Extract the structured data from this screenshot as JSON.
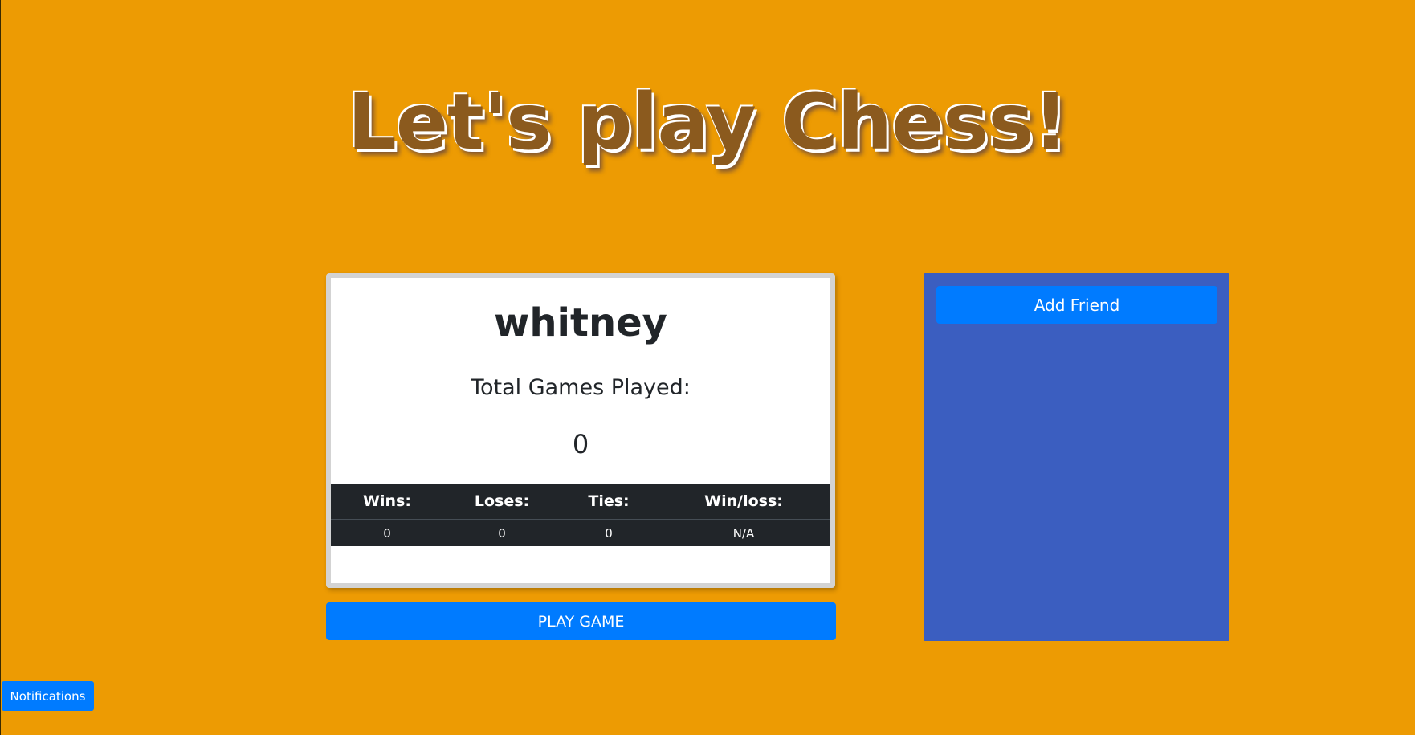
{
  "page": {
    "title": "Let's play Chess!"
  },
  "profile": {
    "username": "whitney",
    "total_games_label": "Total Games Played:",
    "total_games_value": "0",
    "stats": {
      "headers": [
        "Wins:",
        "Loses:",
        "Ties:",
        "Win/loss:"
      ],
      "values": [
        "0",
        "0",
        "0",
        "N/A"
      ]
    }
  },
  "actions": {
    "play_game_label": "PLAY GAME",
    "add_friend_label": "Add Friend",
    "notifications_label": "Notifications"
  },
  "colors": {
    "background": "#ED9B03",
    "primary_button": "#007BFF",
    "friends_panel": "#3B5EC0",
    "table_dark": "#212529",
    "title_text": "#8B5A1E"
  }
}
